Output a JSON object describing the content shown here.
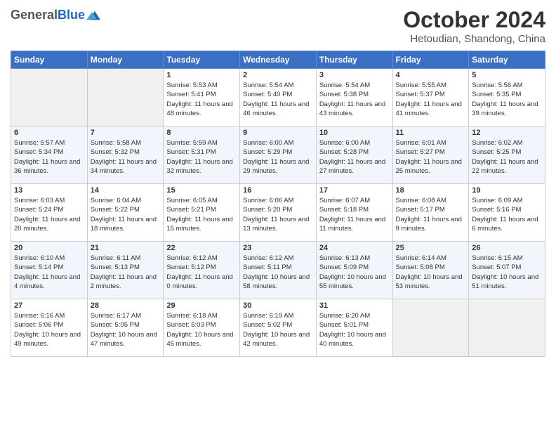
{
  "header": {
    "logo_general": "General",
    "logo_blue": "Blue",
    "title": "October 2024",
    "location": "Hetoudian, Shandong, China"
  },
  "weekdays": [
    "Sunday",
    "Monday",
    "Tuesday",
    "Wednesday",
    "Thursday",
    "Friday",
    "Saturday"
  ],
  "weeks": [
    [
      {
        "day": "",
        "info": ""
      },
      {
        "day": "",
        "info": ""
      },
      {
        "day": "1",
        "info": "Sunrise: 5:53 AM\nSunset: 5:41 PM\nDaylight: 11 hours and 48 minutes."
      },
      {
        "day": "2",
        "info": "Sunrise: 5:54 AM\nSunset: 5:40 PM\nDaylight: 11 hours and 46 minutes."
      },
      {
        "day": "3",
        "info": "Sunrise: 5:54 AM\nSunset: 5:38 PM\nDaylight: 11 hours and 43 minutes."
      },
      {
        "day": "4",
        "info": "Sunrise: 5:55 AM\nSunset: 5:37 PM\nDaylight: 11 hours and 41 minutes."
      },
      {
        "day": "5",
        "info": "Sunrise: 5:56 AM\nSunset: 5:35 PM\nDaylight: 11 hours and 39 minutes."
      }
    ],
    [
      {
        "day": "6",
        "info": "Sunrise: 5:57 AM\nSunset: 5:34 PM\nDaylight: 11 hours and 36 minutes."
      },
      {
        "day": "7",
        "info": "Sunrise: 5:58 AM\nSunset: 5:32 PM\nDaylight: 11 hours and 34 minutes."
      },
      {
        "day": "8",
        "info": "Sunrise: 5:59 AM\nSunset: 5:31 PM\nDaylight: 11 hours and 32 minutes."
      },
      {
        "day": "9",
        "info": "Sunrise: 6:00 AM\nSunset: 5:29 PM\nDaylight: 11 hours and 29 minutes."
      },
      {
        "day": "10",
        "info": "Sunrise: 6:00 AM\nSunset: 5:28 PM\nDaylight: 11 hours and 27 minutes."
      },
      {
        "day": "11",
        "info": "Sunrise: 6:01 AM\nSunset: 5:27 PM\nDaylight: 11 hours and 25 minutes."
      },
      {
        "day": "12",
        "info": "Sunrise: 6:02 AM\nSunset: 5:25 PM\nDaylight: 11 hours and 22 minutes."
      }
    ],
    [
      {
        "day": "13",
        "info": "Sunrise: 6:03 AM\nSunset: 5:24 PM\nDaylight: 11 hours and 20 minutes."
      },
      {
        "day": "14",
        "info": "Sunrise: 6:04 AM\nSunset: 5:22 PM\nDaylight: 11 hours and 18 minutes."
      },
      {
        "day": "15",
        "info": "Sunrise: 6:05 AM\nSunset: 5:21 PM\nDaylight: 11 hours and 15 minutes."
      },
      {
        "day": "16",
        "info": "Sunrise: 6:06 AM\nSunset: 5:20 PM\nDaylight: 11 hours and 13 minutes."
      },
      {
        "day": "17",
        "info": "Sunrise: 6:07 AM\nSunset: 5:18 PM\nDaylight: 11 hours and 11 minutes."
      },
      {
        "day": "18",
        "info": "Sunrise: 6:08 AM\nSunset: 5:17 PM\nDaylight: 11 hours and 9 minutes."
      },
      {
        "day": "19",
        "info": "Sunrise: 6:09 AM\nSunset: 5:16 PM\nDaylight: 11 hours and 6 minutes."
      }
    ],
    [
      {
        "day": "20",
        "info": "Sunrise: 6:10 AM\nSunset: 5:14 PM\nDaylight: 11 hours and 4 minutes."
      },
      {
        "day": "21",
        "info": "Sunrise: 6:11 AM\nSunset: 5:13 PM\nDaylight: 11 hours and 2 minutes."
      },
      {
        "day": "22",
        "info": "Sunrise: 6:12 AM\nSunset: 5:12 PM\nDaylight: 11 hours and 0 minutes."
      },
      {
        "day": "23",
        "info": "Sunrise: 6:12 AM\nSunset: 5:11 PM\nDaylight: 10 hours and 58 minutes."
      },
      {
        "day": "24",
        "info": "Sunrise: 6:13 AM\nSunset: 5:09 PM\nDaylight: 10 hours and 55 minutes."
      },
      {
        "day": "25",
        "info": "Sunrise: 6:14 AM\nSunset: 5:08 PM\nDaylight: 10 hours and 53 minutes."
      },
      {
        "day": "26",
        "info": "Sunrise: 6:15 AM\nSunset: 5:07 PM\nDaylight: 10 hours and 51 minutes."
      }
    ],
    [
      {
        "day": "27",
        "info": "Sunrise: 6:16 AM\nSunset: 5:06 PM\nDaylight: 10 hours and 49 minutes."
      },
      {
        "day": "28",
        "info": "Sunrise: 6:17 AM\nSunset: 5:05 PM\nDaylight: 10 hours and 47 minutes."
      },
      {
        "day": "29",
        "info": "Sunrise: 6:18 AM\nSunset: 5:03 PM\nDaylight: 10 hours and 45 minutes."
      },
      {
        "day": "30",
        "info": "Sunrise: 6:19 AM\nSunset: 5:02 PM\nDaylight: 10 hours and 42 minutes."
      },
      {
        "day": "31",
        "info": "Sunrise: 6:20 AM\nSunset: 5:01 PM\nDaylight: 10 hours and 40 minutes."
      },
      {
        "day": "",
        "info": ""
      },
      {
        "day": "",
        "info": ""
      }
    ]
  ]
}
